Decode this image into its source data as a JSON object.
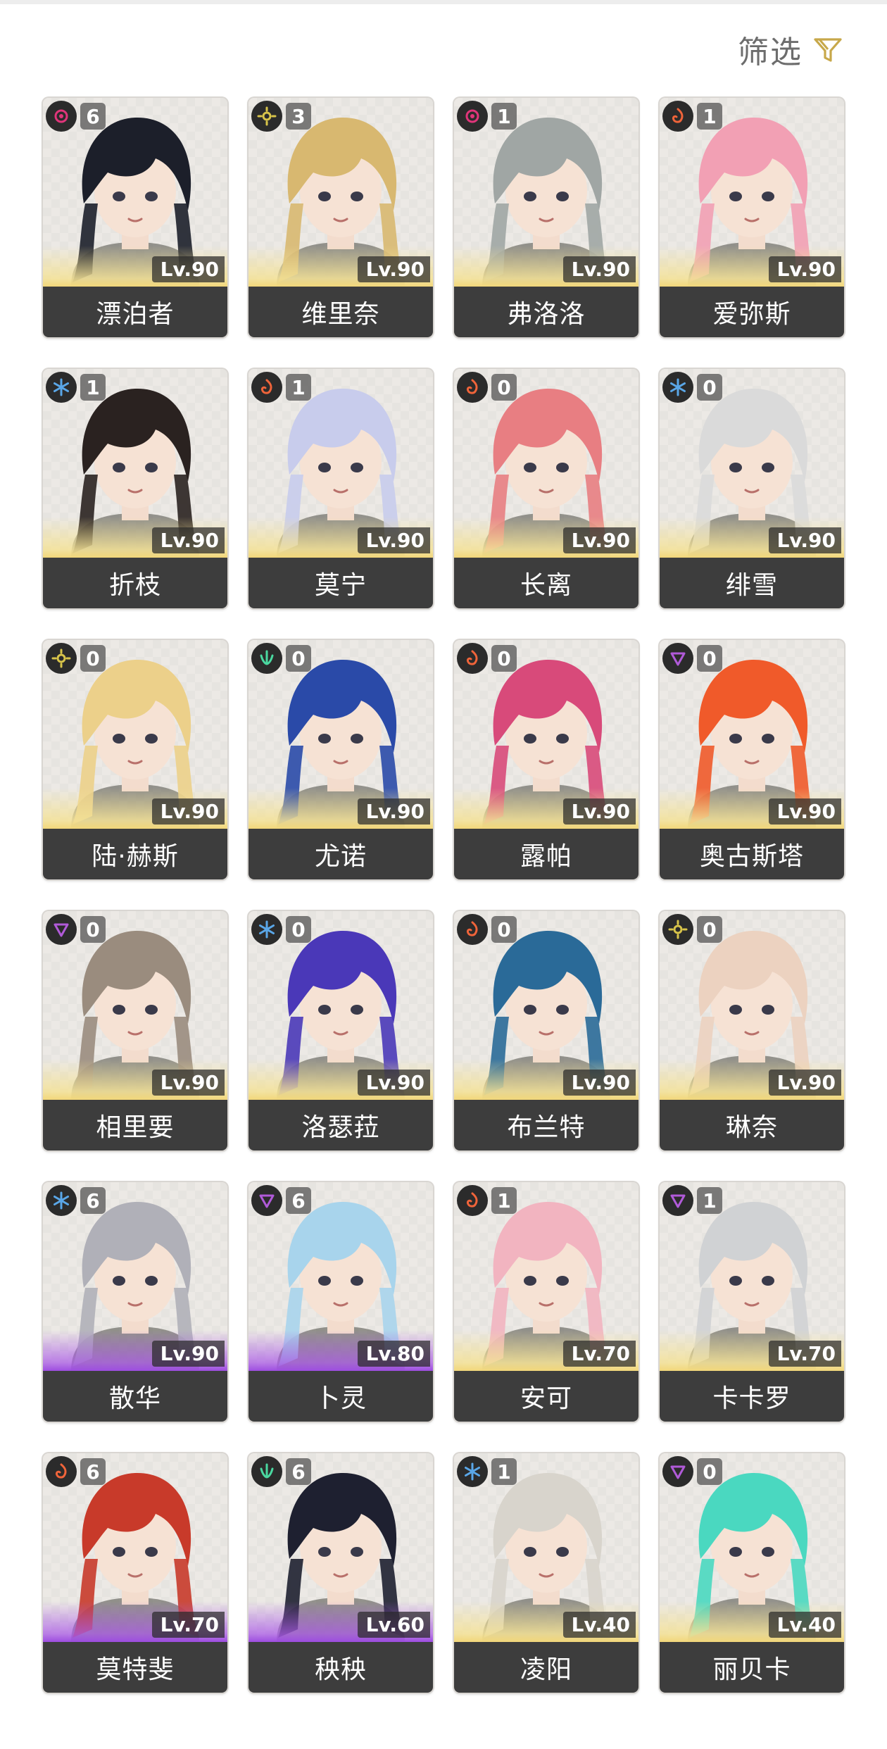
{
  "filter": {
    "label": "筛选",
    "icon": "filter-funnel-icon",
    "icon_color": "#c7a84a"
  },
  "element_colors": {
    "spectro": "#e0357a",
    "havoc": "#b05ad8",
    "fusion": "#f0643a",
    "glacio": "#5aa7e8",
    "electro": "#d8c44a",
    "aero": "#4ad8a0"
  },
  "characters": [
    {
      "name": "漂泊者",
      "element": "spectro",
      "cons": "6",
      "level": "Lv.90",
      "rarity": "gold",
      "hair": "#1c1f2a"
    },
    {
      "name": "维里奈",
      "element": "electro",
      "cons": "3",
      "level": "Lv.90",
      "rarity": "gold",
      "hair": "#d8b870"
    },
    {
      "name": "弗洛洛",
      "element": "spectro",
      "cons": "1",
      "level": "Lv.90",
      "rarity": "gold",
      "hair": "#a0a6a4"
    },
    {
      "name": "爱弥斯",
      "element": "fusion",
      "cons": "1",
      "level": "Lv.90",
      "rarity": "gold",
      "hair": "#f2a0b4"
    },
    {
      "name": "折枝",
      "element": "glacio",
      "cons": "1",
      "level": "Lv.90",
      "rarity": "gold",
      "hair": "#2a2220"
    },
    {
      "name": "莫宁",
      "element": "fusion",
      "cons": "1",
      "level": "Lv.90",
      "rarity": "gold",
      "hair": "#c8ccec"
    },
    {
      "name": "长离",
      "element": "fusion",
      "cons": "0",
      "level": "Lv.90",
      "rarity": "gold",
      "hair": "#e87e82"
    },
    {
      "name": "绯雪",
      "element": "glacio",
      "cons": "0",
      "level": "Lv.90",
      "rarity": "gold",
      "hair": "#dadada"
    },
    {
      "name": "陆·赫斯",
      "element": "electro",
      "cons": "0",
      "level": "Lv.90",
      "rarity": "gold",
      "hair": "#ecd08a"
    },
    {
      "name": "尤诺",
      "element": "aero",
      "cons": "0",
      "level": "Lv.90",
      "rarity": "gold",
      "hair": "#2a4aa8"
    },
    {
      "name": "露帕",
      "element": "fusion",
      "cons": "0",
      "level": "Lv.90",
      "rarity": "gold",
      "hair": "#d84a7a"
    },
    {
      "name": "奥古斯塔",
      "element": "havoc",
      "cons": "0",
      "level": "Lv.90",
      "rarity": "gold",
      "hair": "#f05a2a"
    },
    {
      "name": "相里要",
      "element": "havoc",
      "cons": "0",
      "level": "Lv.90",
      "rarity": "gold",
      "hair": "#9a8c7e"
    },
    {
      "name": "洛瑟菈",
      "element": "glacio",
      "cons": "0",
      "level": "Lv.90",
      "rarity": "gold",
      "hair": "#4a38b8"
    },
    {
      "name": "布兰特",
      "element": "fusion",
      "cons": "0",
      "level": "Lv.90",
      "rarity": "gold",
      "hair": "#2a6a98"
    },
    {
      "name": "琳奈",
      "element": "electro",
      "cons": "0",
      "level": "Lv.90",
      "rarity": "gold",
      "hair": "#ecd2c0"
    },
    {
      "name": "散华",
      "element": "glacio",
      "cons": "6",
      "level": "Lv.90",
      "rarity": "purple",
      "hair": "#b0b0b8"
    },
    {
      "name": "卜灵",
      "element": "havoc",
      "cons": "6",
      "level": "Lv.80",
      "rarity": "purple",
      "hair": "#a8d4ec"
    },
    {
      "name": "安可",
      "element": "fusion",
      "cons": "1",
      "level": "Lv.70",
      "rarity": "gold",
      "hair": "#f2b4c0"
    },
    {
      "name": "卡卡罗",
      "element": "havoc",
      "cons": "1",
      "level": "Lv.70",
      "rarity": "gold",
      "hair": "#d0d2d4"
    },
    {
      "name": "莫特斐",
      "element": "fusion",
      "cons": "6",
      "level": "Lv.70",
      "rarity": "purple",
      "hair": "#c83a2a"
    },
    {
      "name": "秧秧",
      "element": "aero",
      "cons": "6",
      "level": "Lv.60",
      "rarity": "purple",
      "hair": "#1e2030"
    },
    {
      "name": "凌阳",
      "element": "glacio",
      "cons": "1",
      "level": "Lv.40",
      "rarity": "gold",
      "hair": "#d8d4cc"
    },
    {
      "name": "丽贝卡",
      "element": "havoc",
      "cons": "0",
      "level": "Lv.40",
      "rarity": "gold",
      "hair": "#4ad8c0"
    }
  ]
}
